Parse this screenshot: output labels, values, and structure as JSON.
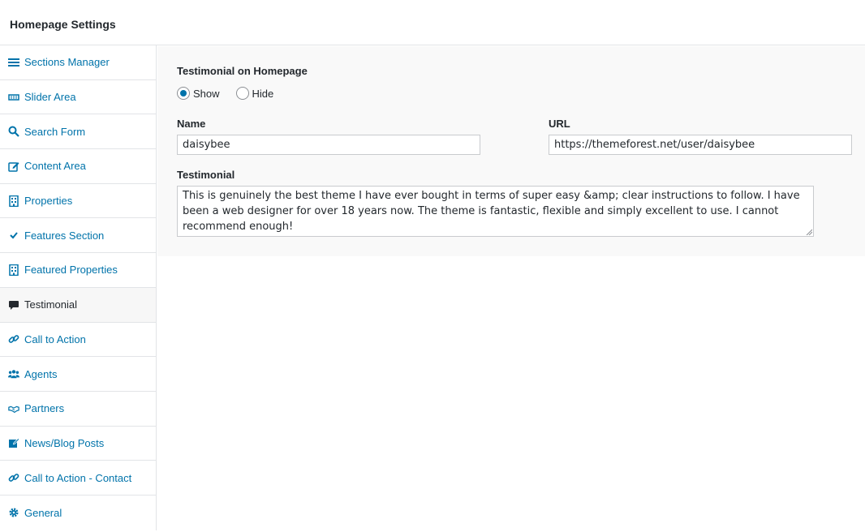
{
  "header": {
    "title": "Homepage Settings"
  },
  "sidebar": {
    "items": [
      {
        "label": "Sections Manager",
        "icon": "bars-icon"
      },
      {
        "label": "Slider Area",
        "icon": "slider-icon"
      },
      {
        "label": "Search Form",
        "icon": "search-icon"
      },
      {
        "label": "Content Area",
        "icon": "edit-icon"
      },
      {
        "label": "Properties",
        "icon": "building-icon"
      },
      {
        "label": "Features Section",
        "icon": "check-icon"
      },
      {
        "label": "Featured Properties",
        "icon": "building-icon"
      },
      {
        "label": "Testimonial",
        "icon": "comment-icon"
      },
      {
        "label": "Call to Action",
        "icon": "link-icon"
      },
      {
        "label": "Agents",
        "icon": "users-icon"
      },
      {
        "label": "Partners",
        "icon": "handshake-icon"
      },
      {
        "label": "News/Blog Posts",
        "icon": "edit-post-icon"
      },
      {
        "label": "Call to Action - Contact",
        "icon": "link-icon"
      },
      {
        "label": "General",
        "icon": "gear-icon"
      }
    ],
    "active_index": 7
  },
  "main": {
    "section_title": "Testimonial on Homepage",
    "visibility": {
      "options": [
        "Show",
        "Hide"
      ],
      "selected": "Show"
    },
    "name": {
      "label": "Name",
      "value": "daisybee"
    },
    "url": {
      "label": "URL",
      "value": "https://themeforest.net/user/daisybee"
    },
    "testimonial": {
      "label": "Testimonial",
      "value": "This is genuinely the best theme I have ever bought in terms of super easy &amp; clear instructions to follow. I have been a web designer for over 18 years now. The theme is fantastic, flexible and simply excellent to use. I cannot recommend enough!"
    }
  },
  "colors": {
    "link": "#0073aa",
    "text": "#23282d",
    "border": "#e2e4e7",
    "panel_bg": "#f9f9f9"
  }
}
